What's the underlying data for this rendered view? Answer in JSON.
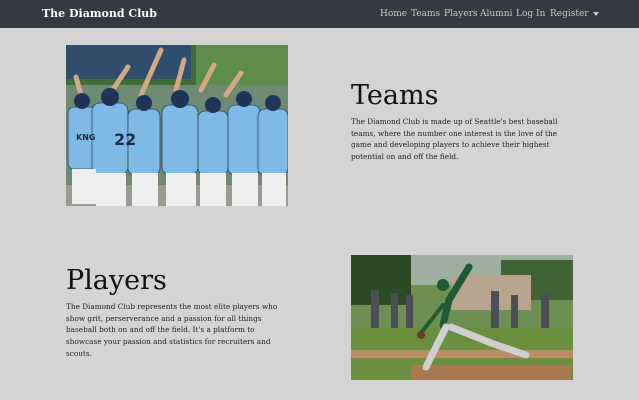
{
  "nav": {
    "brand": "The Diamond Club",
    "links": [
      "Home",
      "Teams",
      "Players",
      "Alumni",
      "Log In"
    ],
    "register": "Register"
  },
  "teams": {
    "title": "Teams",
    "text": "The Diamond Club is made up of Seattle's best baseball teams, where the number one interest is the love of the game and developing players to achieve their highest potential on and off the field.",
    "photo_icon": "team-huddle-photo"
  },
  "players": {
    "title": "Players",
    "text": "The Diamond Club represents the most elite players who show grit, perserverance and a passion for all things baseball both on and off the field. It's a platform to showcase your passion and statistics for recruiters and scouts.",
    "photo_icon": "pitcher-photo"
  },
  "colors": {
    "navbar": "#343a40",
    "background": "#d4d4d4"
  }
}
